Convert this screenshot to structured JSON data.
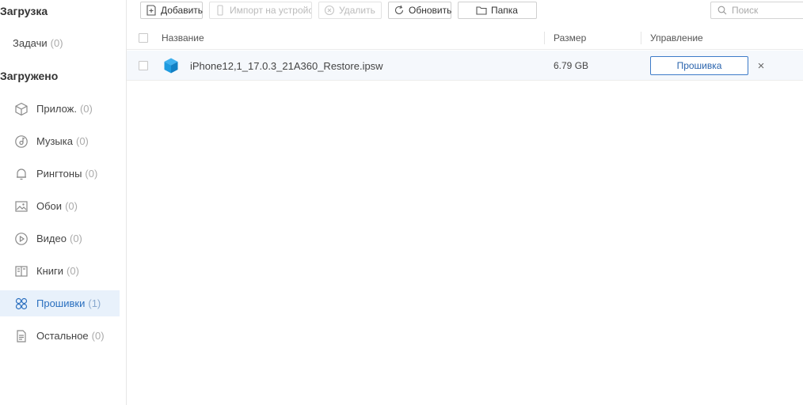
{
  "sidebar": {
    "download_title": "Загрузка",
    "tasks": {
      "label": "Задачи",
      "count": "(0)"
    },
    "downloaded_title": "Загружено",
    "items": [
      {
        "label": "Прилож.",
        "count": "(0)",
        "icon": "app-icon"
      },
      {
        "label": "Музыка",
        "count": "(0)",
        "icon": "music-icon"
      },
      {
        "label": "Рингтоны",
        "count": "(0)",
        "icon": "bell-icon"
      },
      {
        "label": "Обои",
        "count": "(0)",
        "icon": "image-icon"
      },
      {
        "label": "Видео",
        "count": "(0)",
        "icon": "video-icon"
      },
      {
        "label": "Книги",
        "count": "(0)",
        "icon": "book-icon"
      },
      {
        "label": "Прошивки",
        "count": "(1)",
        "icon": "firmware-icon",
        "active": true
      },
      {
        "label": "Остальное",
        "count": "(0)",
        "icon": "document-icon"
      }
    ]
  },
  "toolbar": {
    "add_label": "Добавить",
    "import_label": "Импорт на устройств",
    "delete_label": "Удалить",
    "refresh_label": "Обновить",
    "folder_label": "Папка",
    "search_placeholder": "Поиск"
  },
  "table": {
    "columns": {
      "name": "Название",
      "size": "Размер",
      "actions": "Управление"
    },
    "rows": [
      {
        "name": "iPhone12,1_17.0.3_21A360_Restore.ipsw",
        "size": "6.79 GB",
        "action_label": "Прошивка",
        "icon": "cube-icon"
      }
    ]
  },
  "colors": {
    "accent": "#2a6fbf",
    "active_bg": "#e8f1fb",
    "row_bg": "#f5f8fc",
    "file_icon": "#1e9be0"
  }
}
